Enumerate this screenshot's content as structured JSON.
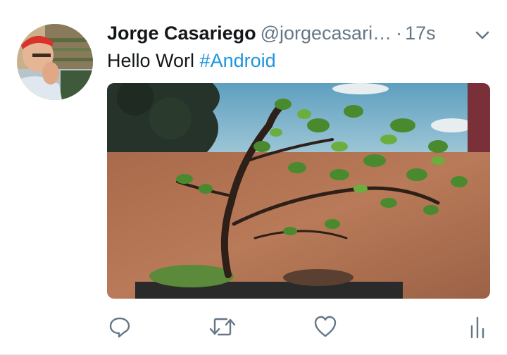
{
  "tweet": {
    "author_name": "Jorge Casariego",
    "handle": "@jorgecasari…",
    "separator": "·",
    "time": "17s",
    "text_plain": "Hello Worl ",
    "hashtag": "#Android"
  },
  "icons": {
    "avatar": "avatar",
    "caret": "chevron-down-icon",
    "reply": "reply-icon",
    "retweet": "retweet-icon",
    "like": "heart-icon",
    "analytics": "analytics-icon"
  },
  "colors": {
    "name": "#14171a",
    "secondary": "#657786",
    "link": "#1b95e0",
    "icon": "#657786"
  }
}
